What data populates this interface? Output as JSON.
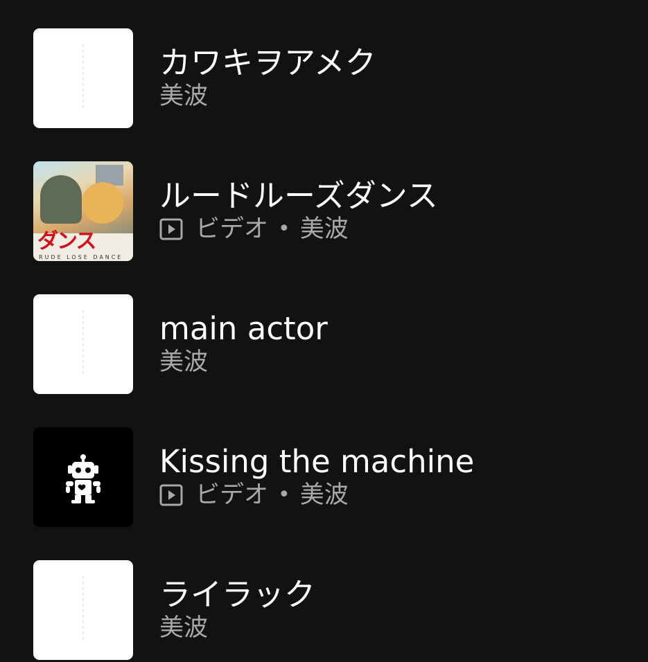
{
  "tracks": [
    {
      "title": "カワキヲアメク",
      "artist": "美波",
      "type": "",
      "thumb_style": "white",
      "thumb_icon": "album-art-placeholder"
    },
    {
      "title": "ルードルーズダンス",
      "artist": "美波",
      "type": "ビデオ",
      "separator": "•",
      "thumb_style": "art",
      "thumb_text": "ダンス",
      "thumb_subtext": "RUDE LOSE DANCE"
    },
    {
      "title": "main actor",
      "artist": "美波",
      "type": "",
      "thumb_style": "white"
    },
    {
      "title": "Kissing the machine",
      "artist": "美波",
      "type": "ビデオ",
      "separator": "•",
      "thumb_style": "black",
      "thumb_icon": "robot-icon"
    },
    {
      "title": "ライラック",
      "artist": "美波",
      "type": "",
      "thumb_style": "white"
    }
  ],
  "colors": {
    "background": "#121212",
    "title": "#ffffff",
    "subtitle": "#a8a8a8"
  }
}
